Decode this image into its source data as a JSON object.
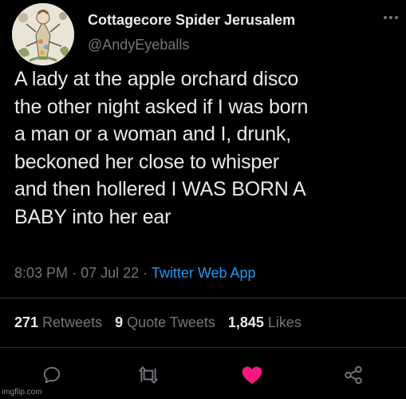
{
  "user": {
    "display_name": "Cottagecore Spider Jerusalem",
    "handle": "@AndyEyeballs",
    "avatar_icon": "avatar-illustration"
  },
  "tweet": {
    "lines": [
      "A lady at the apple orchard disco",
      "the other night asked if I was born",
      "a man or a woman and I, drunk,",
      "beckoned her close to whisper",
      "and then hollered I WAS BORN A",
      "BABY into her ear"
    ],
    "time": "8:03 PM",
    "date": "07 Jul 22",
    "separator": "·",
    "source": "Twitter Web App"
  },
  "stats": {
    "retweets_count": "271",
    "retweets_label": "Retweets",
    "quotes_count": "9",
    "quotes_label": "Quote Tweets",
    "likes_count": "1,845",
    "likes_label": "Likes"
  },
  "actions": {
    "reply_icon": "reply-icon",
    "retweet_icon": "retweet-icon",
    "like_icon": "heart-icon",
    "share_icon": "share-icon",
    "liked": true
  },
  "colors": {
    "background": "#000000",
    "text": "#e7e9ea",
    "muted": "#71767b",
    "link": "#1d9bf0",
    "like": "#f91880",
    "divider": "#2f3336"
  },
  "watermark": "imgflip.com"
}
